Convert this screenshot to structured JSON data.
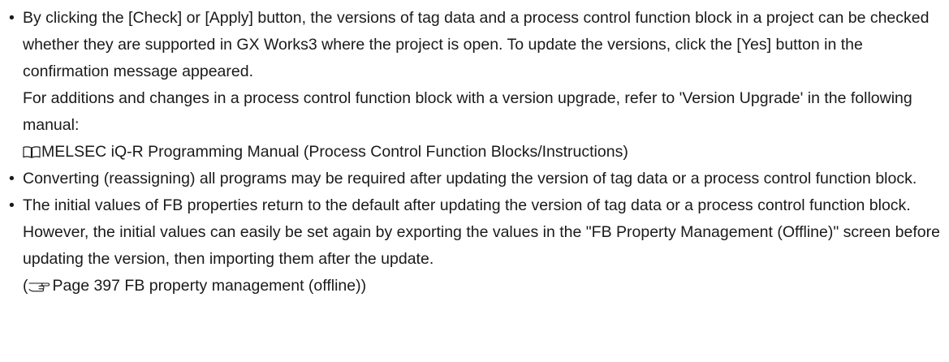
{
  "bullets": [
    {
      "symbol": "•",
      "paragraphs": [
        "By clicking the [Check] or [Apply] button, the versions of tag data and a process control function block in a project can be checked whether they are supported in GX Works3 where the project is open. To update the versions, click the [Yes] button in the confirmation message appeared.",
        "For additions and changes in a process control function block with a version upgrade, refer to 'Version Upgrade' in the following manual:"
      ],
      "manual_ref": {
        "icon": "manual-book-icon",
        "text": "MELSEC iQ-R Programming Manual (Process Control Function Blocks/Instructions)"
      }
    },
    {
      "symbol": "•",
      "paragraphs": [
        "Converting (reassigning) all programs may be required after updating the version of tag data or a process control function block."
      ]
    },
    {
      "symbol": "•",
      "paragraphs": [
        "The initial values of FB properties return to the default after updating the version of tag data or a process control function block. However, the initial values can easily be set again by exporting the values in the \"FB Property Management (Offline)\" screen before updating the version, then importing them after the update."
      ],
      "page_ref": {
        "open": "(",
        "icon": "pointing-hand-icon",
        "text": "Page 397 FB property management (offline)",
        "close": ")"
      }
    }
  ]
}
